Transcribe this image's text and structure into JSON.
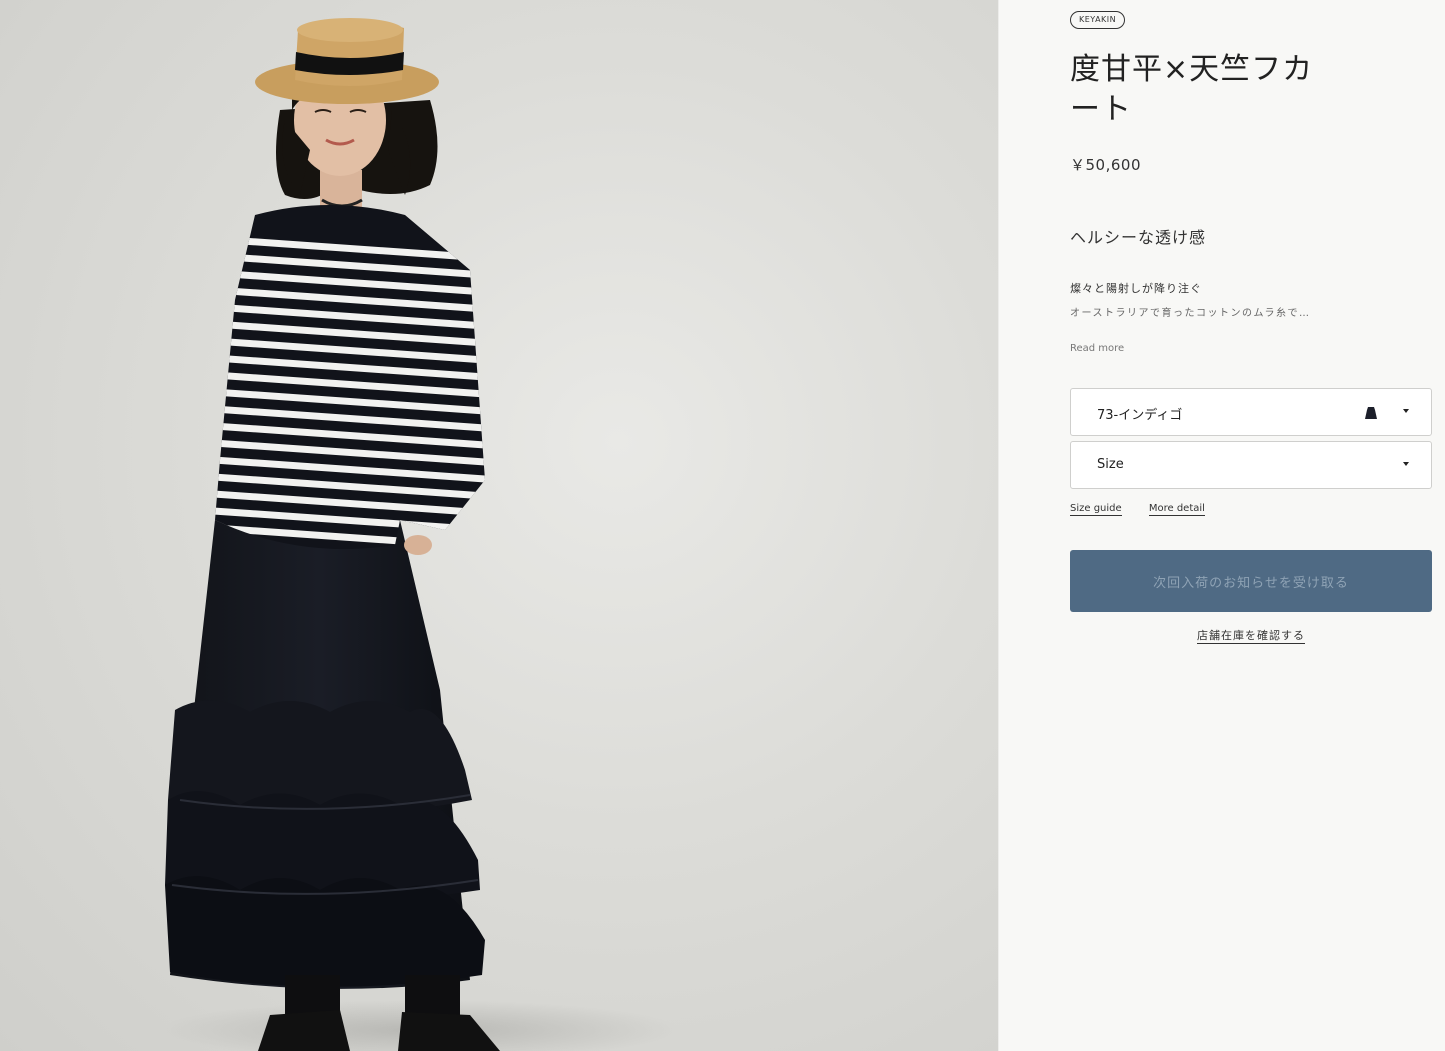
{
  "product": {
    "badge": "KEYAKIN",
    "title": "度甘平×天竺フカート",
    "price": "￥50,600",
    "headline": "ヘルシーな透け感",
    "description_lead": "燦々と陽射しが降り注ぐ",
    "description": "オーストラリアで育ったコットンのムラ糸で…",
    "read_more": "Read more"
  },
  "options": {
    "color_value": "73-インディゴ",
    "size_placeholder": "Size"
  },
  "links": {
    "size_guide": "Size guide",
    "more_detail": "More detail"
  },
  "actions": {
    "notify_button": "次回入荷のお知らせを受け取る",
    "store_stock": "店舗在庫を確認する"
  },
  "colors": {
    "cta_bg": "#4f6a84",
    "swatch": "#1c1f2a"
  },
  "icons": {
    "color_swatch": "swatch-icon",
    "dropdown": "chevron-down-icon"
  }
}
